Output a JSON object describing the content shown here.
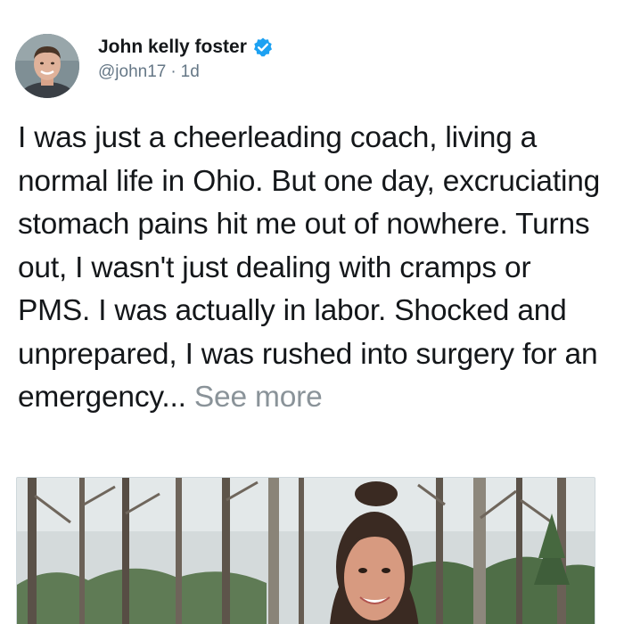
{
  "author": {
    "display_name": "John kelly foster",
    "handle": "@john17",
    "separator": "·",
    "timestamp": "1d",
    "verified": true
  },
  "tweet": {
    "text": "I was just a cheerleading coach, living a normal life in Ohio. But one day, excruciating stomach pains hit me out of nowhere. Turns out, I wasn't just dealing with cramps or PMS. I was actually in labor. Shocked and unprepared, I was rushed into surgery for an emergency...",
    "see_more_label": "See more"
  },
  "colors": {
    "text_primary": "#14171a",
    "text_secondary": "#657786",
    "see_more": "#8a9399",
    "verified_badge": "#1da1f2"
  },
  "icons": {
    "verified": "verified-badge-icon",
    "avatar": "profile-avatar",
    "media": "attached-photo"
  }
}
